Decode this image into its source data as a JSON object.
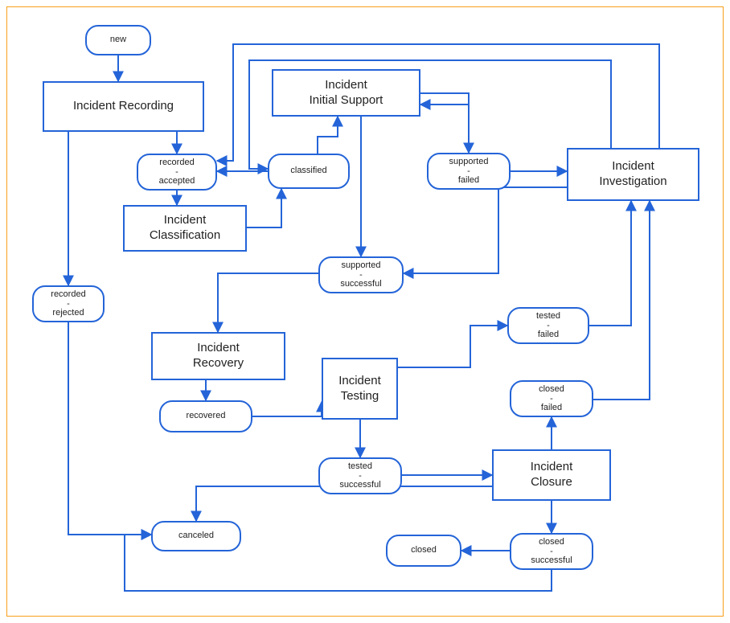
{
  "nodes": {
    "new": "new",
    "recording": "Incident Recording",
    "recorded_accepted_1": "recorded",
    "recorded_accepted_2": "accepted",
    "recorded_rejected_1": "recorded",
    "recorded_rejected_2": "rejected",
    "classification": "Incident\nClassification",
    "classified": "classified",
    "initial_support": "Incident\nInitial Support",
    "supported_failed_1": "supported",
    "supported_failed_2": "failed",
    "supported_success_1": "supported",
    "supported_success_2": "successful",
    "investigation": "Incident\nInvestigation",
    "recovery": "Incident\nRecovery",
    "recovered": "recovered",
    "testing": "Incident\nTesting",
    "tested_failed_1": "tested",
    "tested_failed_2": "failed",
    "tested_success_1": "tested",
    "tested_success_2": "successful",
    "closure": "Incident\nClosure",
    "closed_failed_1": "closed",
    "closed_failed_2": "failed",
    "closed_success_1": "closed",
    "closed_success_2": "successful",
    "closed": "closed",
    "canceled": "canceled"
  },
  "colors": {
    "stroke": "#2464d8",
    "frame": "#f7a01a"
  }
}
